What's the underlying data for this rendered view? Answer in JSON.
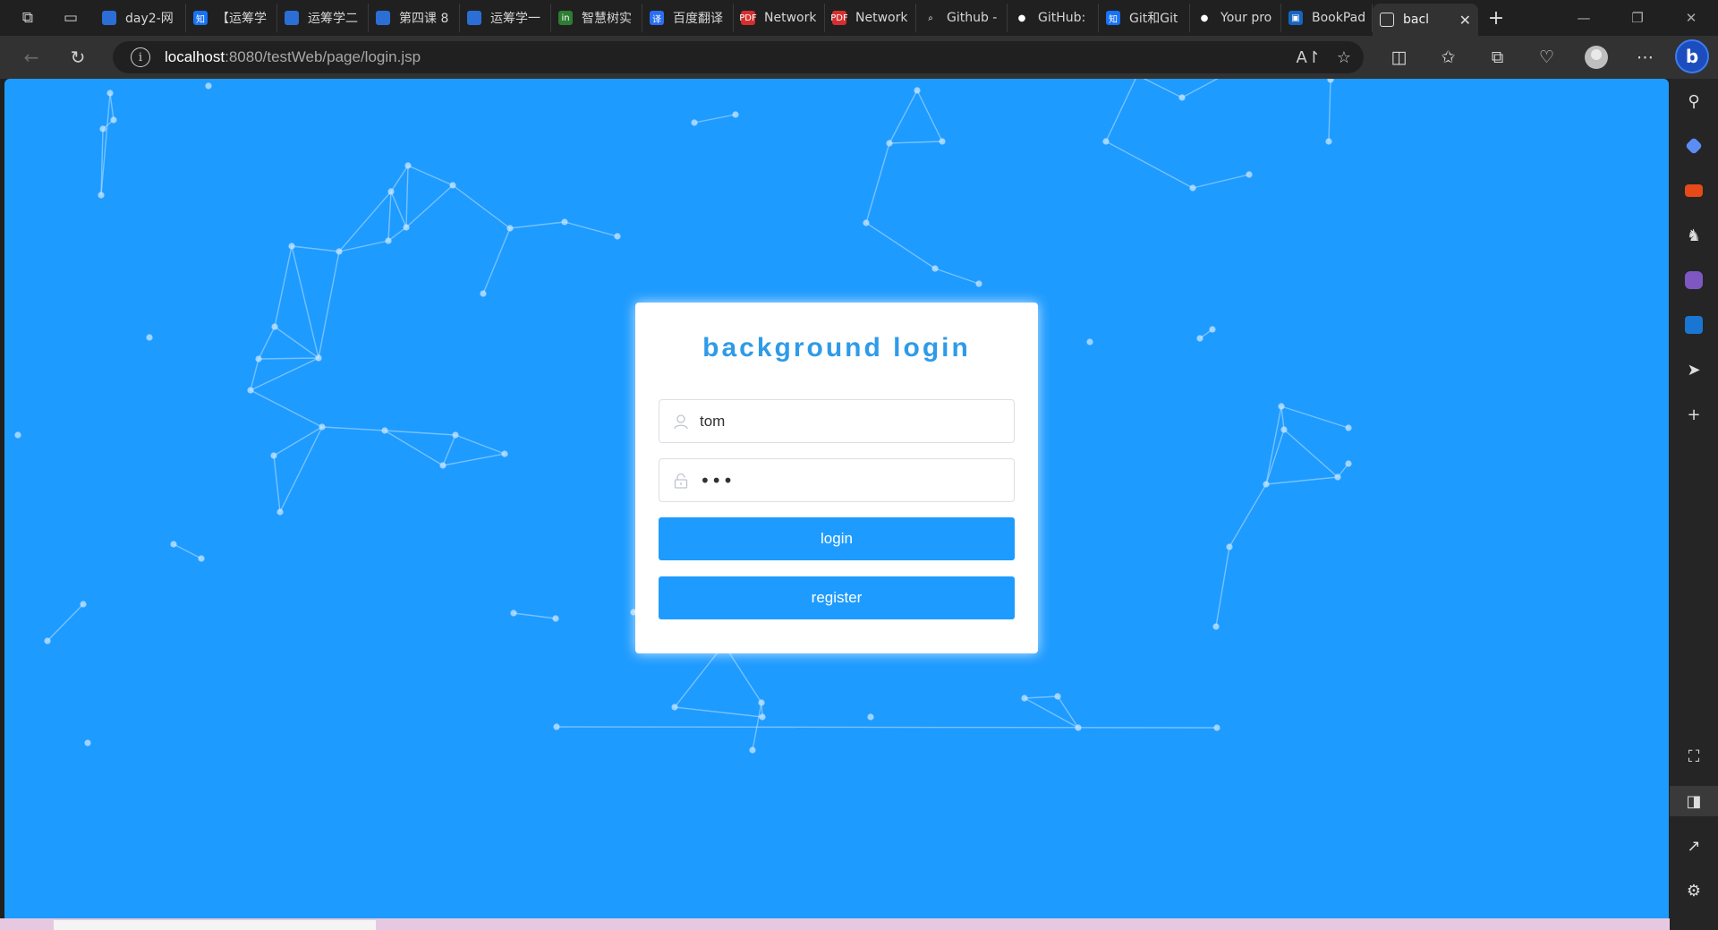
{
  "browser": {
    "tabs": [
      {
        "title": "day2-网",
        "fav_color": "#2b6fd6",
        "fav_text": ""
      },
      {
        "title": "【运筹学",
        "fav_color": "#1772f6",
        "fav_text": "知"
      },
      {
        "title": "运筹学二",
        "fav_color": "#2b6fd6",
        "fav_text": ""
      },
      {
        "title": "第四课 8",
        "fav_color": "#2b6fd6",
        "fav_text": ""
      },
      {
        "title": "运筹学一",
        "fav_color": "#2b6fd6",
        "fav_text": ""
      },
      {
        "title": "智慧树实",
        "fav_color": "#2e7d32",
        "fav_text": "in"
      },
      {
        "title": "百度翻译",
        "fav_color": "#2a6ef4",
        "fav_text": "译"
      },
      {
        "title": "Network",
        "fav_color": "#d32f2f",
        "fav_text": "PDF"
      },
      {
        "title": "Network",
        "fav_color": "#d32f2f",
        "fav_text": "PDF"
      },
      {
        "title": "Github -",
        "fav_color": "#202020",
        "fav_text": "⌕"
      },
      {
        "title": "GitHub:",
        "fav_color": "#202020",
        "fav_text": "●"
      },
      {
        "title": "Git和Git",
        "fav_color": "#1772f6",
        "fav_text": "知"
      },
      {
        "title": "Your pro",
        "fav_color": "#202020",
        "fav_text": "●"
      },
      {
        "title": "BookPad",
        "fav_color": "#1565c0",
        "fav_text": "▣"
      }
    ],
    "active_tab": {
      "title": "bacl",
      "close": "✕"
    },
    "new_tab": "+",
    "window_controls": {
      "minimize": "—",
      "restore": "❐",
      "close": "✕"
    },
    "url_host": "localhost",
    "url_path": ":8080/testWeb/page/login.jsp",
    "address_icons": [
      "read-aloud-icon",
      "favorite-star-icon"
    ],
    "bing_label": "b"
  },
  "login": {
    "title": "background login",
    "username_value": "tom",
    "password_mask": "•••",
    "login_label": "login",
    "register_label": "register"
  },
  "colors": {
    "page_bg": "#1e9bff",
    "title": "#2f9be8",
    "button": "#1e9bff"
  }
}
